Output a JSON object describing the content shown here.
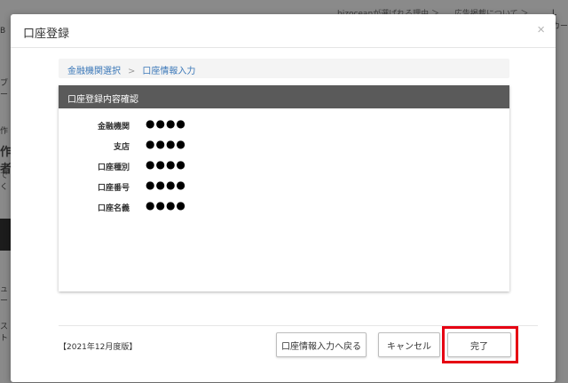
{
  "background": {
    "top_links": [
      "bizoceanが選ばれる理由 ＞",
      "広告掲載について ＞"
    ],
    "right_frag": [
      "L",
      "カー"
    ],
    "left_frags": [
      "B",
      "ブー",
      "作",
      "作者",
      "でく",
      "ュー",
      "スト"
    ]
  },
  "modal": {
    "title": "口座登録",
    "close_glyph": "×"
  },
  "breadcrumb": {
    "step1": "金融機関選択",
    "separator": ">",
    "step2": "口座情報入力"
  },
  "card": {
    "header": "口座登録内容確認",
    "rows": [
      {
        "label": "金融機関",
        "value": "●●●●"
      },
      {
        "label": "支店",
        "value": "●●●●"
      },
      {
        "label": "口座種別",
        "value": "●●●●"
      },
      {
        "label": "口座番号",
        "value": "●●●●"
      },
      {
        "label": "口座名義",
        "value": "●●●●"
      }
    ]
  },
  "footer": {
    "version": "【2021年12月度版】",
    "back_label": "口座情報入力へ戻る",
    "cancel_label": "キャンセル",
    "done_label": "完了"
  },
  "colors": {
    "highlight": "#e60012",
    "header_bg": "#5a5a5a",
    "link": "#3a77b8"
  }
}
